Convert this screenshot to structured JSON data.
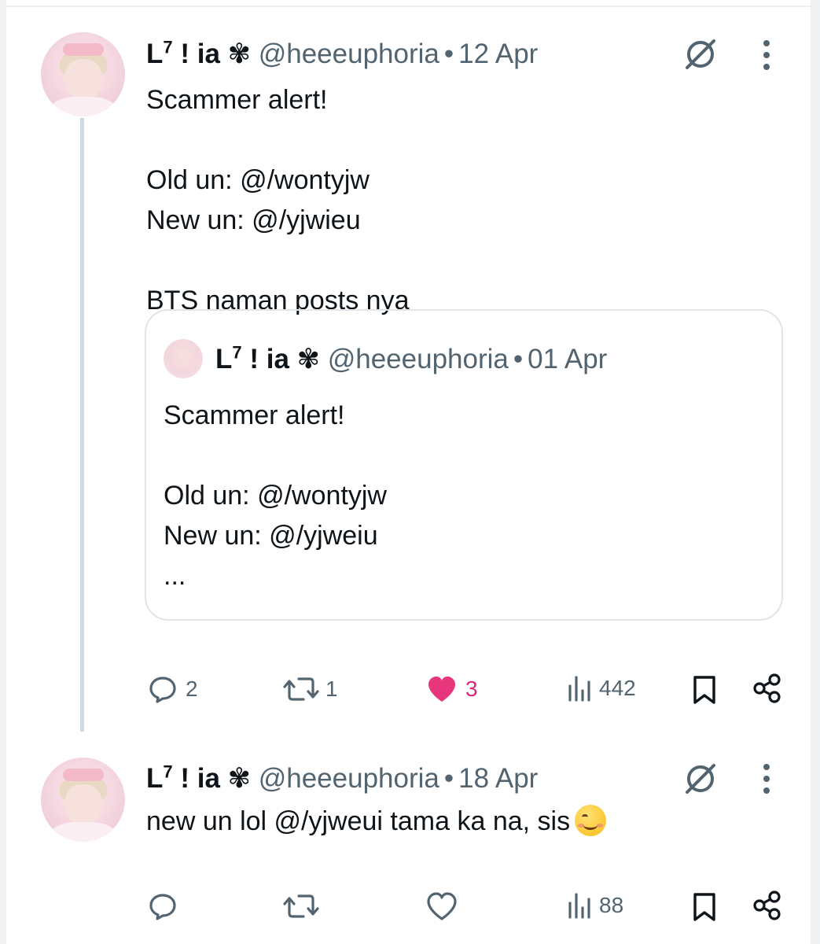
{
  "tweets": [
    {
      "name": "L",
      "name_sup": "7",
      "name_rest": " ! ia ✾",
      "handle": "@heeeuphoria",
      "separator": "•",
      "date": "12 Apr",
      "text": "Scammer alert!\n\nOld un: @/wontyjw\nNew un: @/yjwieu\n\nBTS naman posts nya",
      "quote": {
        "name": "L",
        "name_sup": "7",
        "name_rest": " ! ia ✾",
        "handle": "@heeeuphoria",
        "separator": "•",
        "date": "01 Apr",
        "text": "Scammer alert!\n\nOld un: @/wontyjw\nNew un: @/yjweiu\n..."
      },
      "actions": {
        "replies": "2",
        "reposts": "1",
        "likes": "3",
        "views": "442"
      }
    },
    {
      "name": "L",
      "name_sup": "7",
      "name_rest": " ! ia ✾",
      "handle": "@heeeuphoria",
      "separator": "•",
      "date": "18 Apr",
      "text": "new un lol @/yjweui tama ka na, sis",
      "emoji": "smiling-face-emoji",
      "actions": {
        "replies": "",
        "reposts": "",
        "likes": "",
        "views": "88"
      }
    }
  ],
  "colors": {
    "text": "#0f1419",
    "secondary": "#536471",
    "like_active": "#f91880",
    "border": "#dfe5e9",
    "thread_line": "#cfd9de"
  },
  "icons": [
    "grok-icon",
    "more-icon",
    "reply-icon",
    "repost-icon",
    "like-icon",
    "views-icon",
    "bookmark-icon",
    "share-icon"
  ]
}
